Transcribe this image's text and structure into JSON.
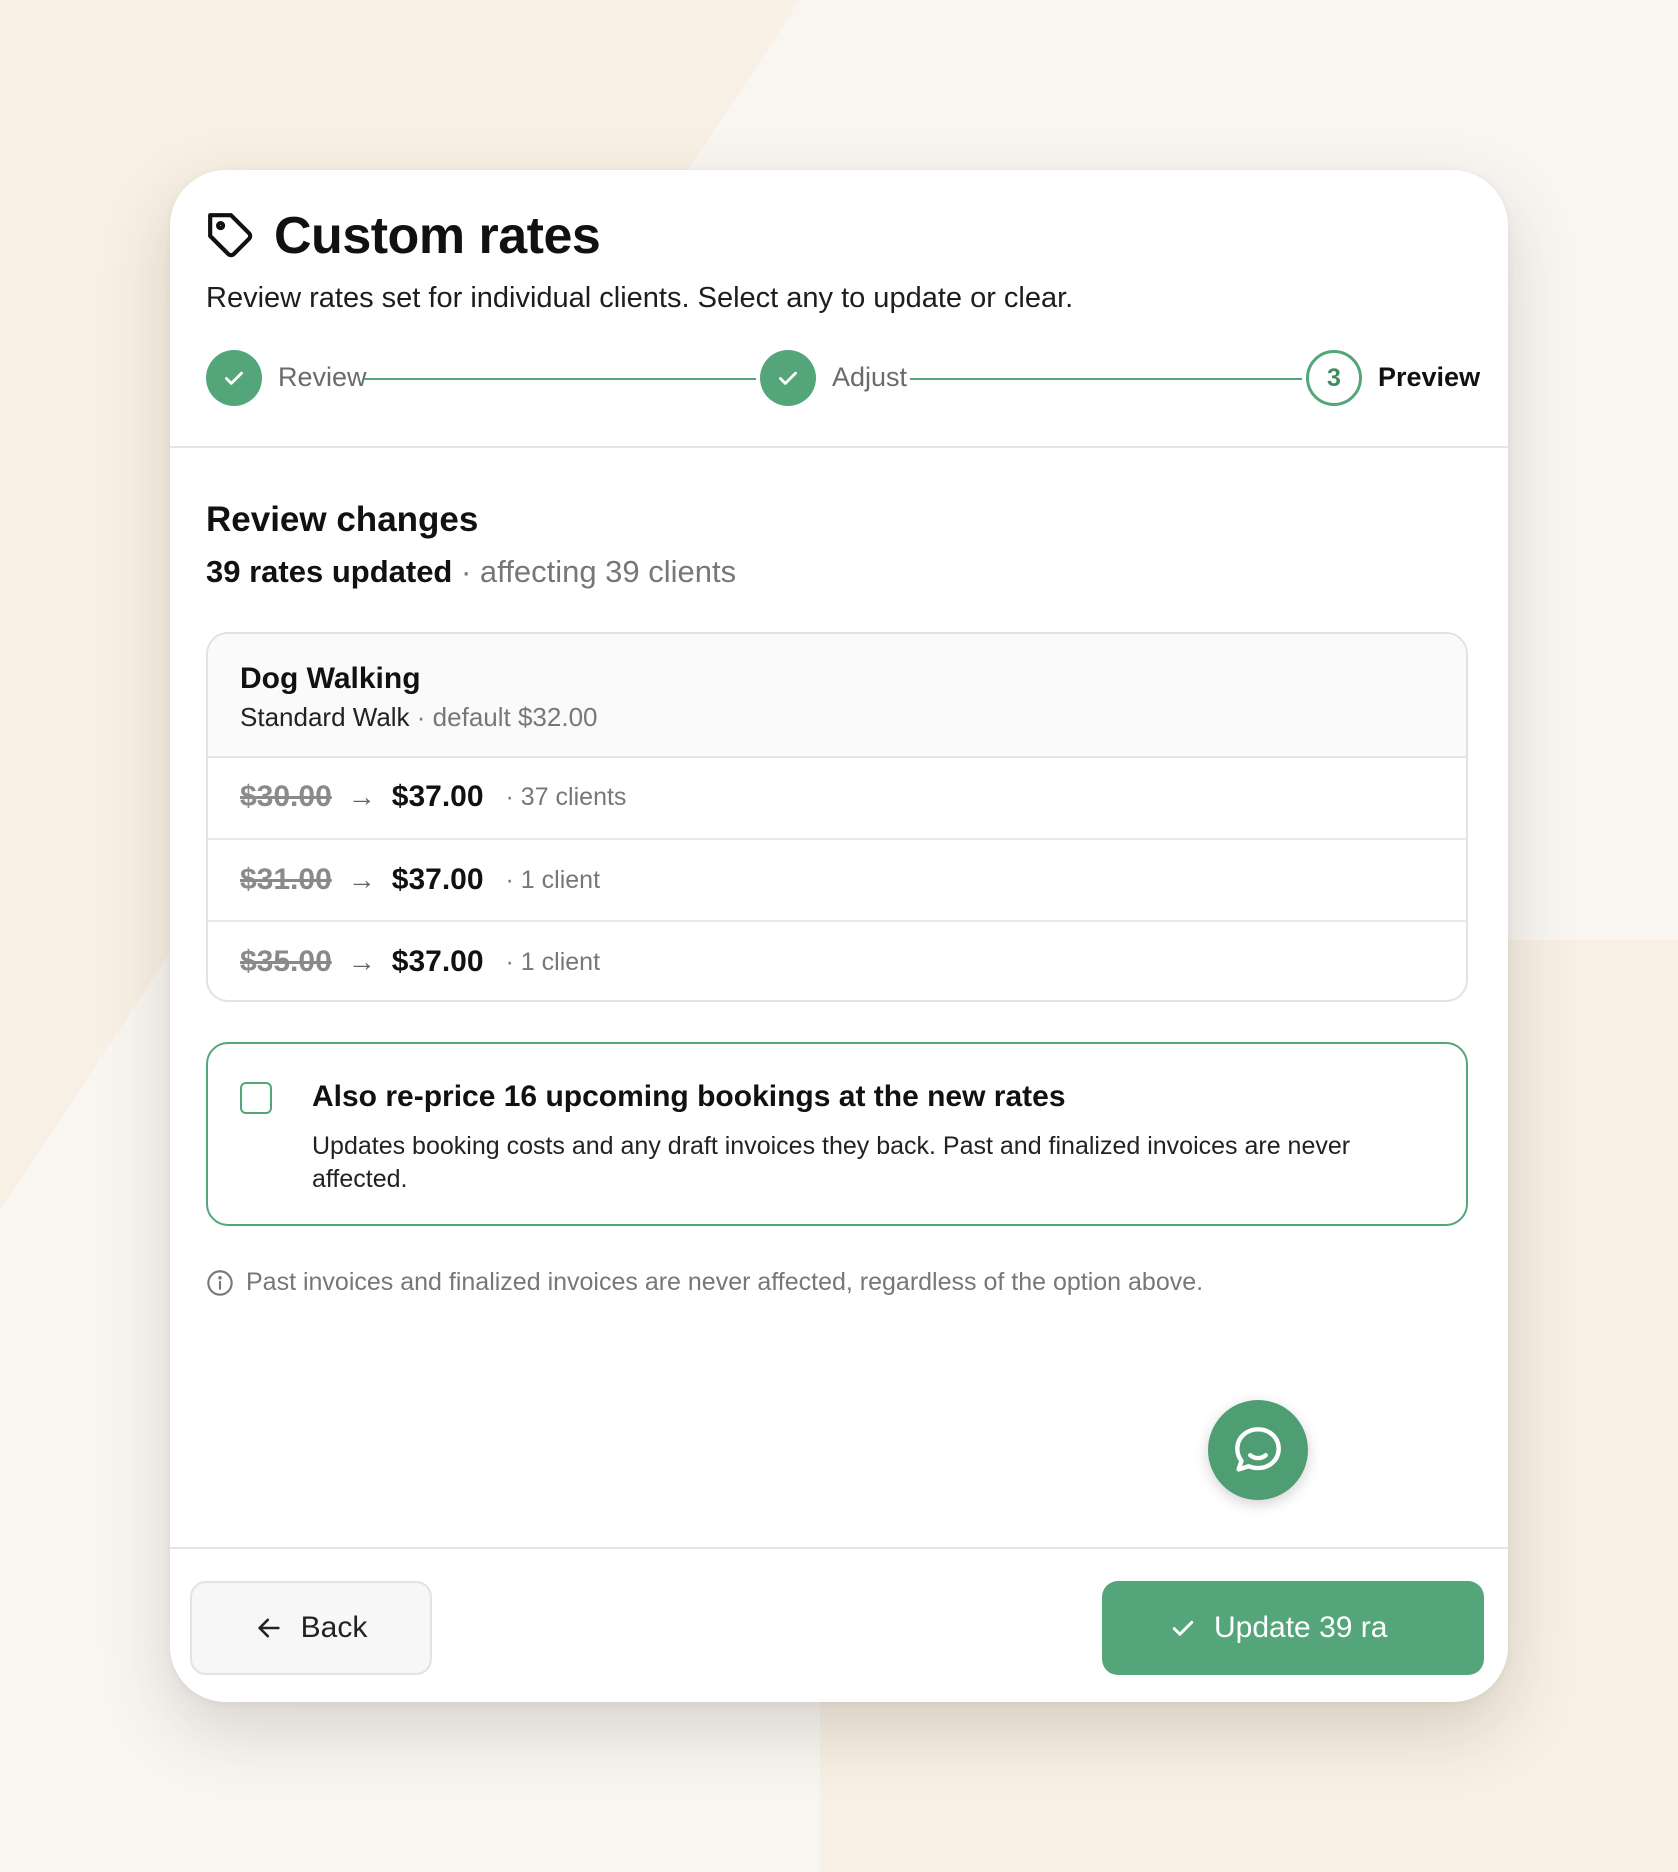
{
  "header": {
    "title": "Custom rates",
    "subtitle": "Review rates set for individual clients. Select any to update or clear."
  },
  "stepper": {
    "steps": [
      {
        "label": "Review",
        "state": "done"
      },
      {
        "label": "Adjust",
        "state": "done"
      },
      {
        "label": "Preview",
        "state": "active",
        "number": "3"
      }
    ]
  },
  "review": {
    "title": "Review changes",
    "summary_strong": "39 rates updated",
    "summary_muted": "· affecting 39 clients"
  },
  "service": {
    "name": "Dog Walking",
    "variant": "Standard Walk",
    "default_text": "· default $32.00",
    "rows": [
      {
        "old": "$30.00",
        "new": "$37.00",
        "count": "· 37 clients"
      },
      {
        "old": "$31.00",
        "new": "$37.00",
        "count": "· 1 client"
      },
      {
        "old": "$35.00",
        "new": "$37.00",
        "count": "· 1 client"
      }
    ]
  },
  "option": {
    "checked": false,
    "title": "Also re-price 16 upcoming bookings at the new rates",
    "description": "Updates booking costs and any draft invoices they back. Past and finalized invoices are never affected."
  },
  "note": "Past invoices and finalized invoices are never affected, regardless of the option above.",
  "footer": {
    "back_label": "Back",
    "primary_label": "Update 39 ra"
  },
  "colors": {
    "accent": "#54a67a",
    "background": "#f9f6f2",
    "background_shape": "#f8f0e4"
  },
  "icons": {
    "title": "tag-icon",
    "step_done": "check-icon",
    "arrow": "arrow-right-icon",
    "note": "info-icon",
    "back": "arrow-left-icon",
    "primary": "check-icon",
    "chat": "chat-icon"
  }
}
